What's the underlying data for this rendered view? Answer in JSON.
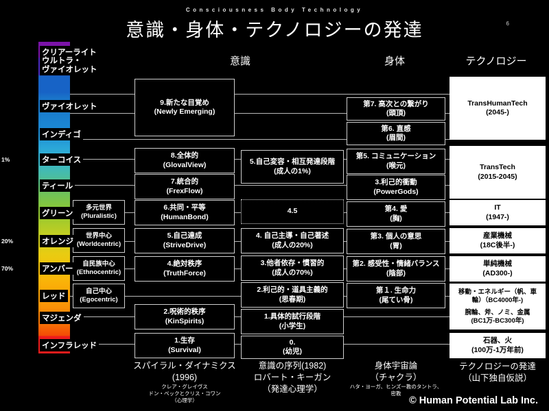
{
  "header": {
    "eyebrow": "Consciousness  Body  Technology",
    "title": "意識・身体・テクノロジーの発達",
    "page_number": "6"
  },
  "column_headings": {
    "consciousness": "意識",
    "body": "身体",
    "technology": "テクノロジー"
  },
  "spectrum": {
    "levels": [
      {
        "label": "クリアーライト",
        "pct": ""
      },
      {
        "label": "ウルトラ・\nヴァイオレット",
        "pct": ""
      },
      {
        "label": "ヴァイオレット",
        "pct": ""
      },
      {
        "label": "インディゴ",
        "pct": ""
      },
      {
        "label": "ターコイス",
        "pct": "1%"
      },
      {
        "label": "ティール",
        "pct": ""
      },
      {
        "label": "グリーン",
        "pct": ""
      },
      {
        "label": "オレンジ",
        "pct": "20%"
      },
      {
        "label": "アンバー",
        "pct": "70%"
      },
      {
        "label": "レッド",
        "pct": ""
      },
      {
        "label": "マジェンダ",
        "pct": ""
      },
      {
        "label": "インフラレッド",
        "pct": ""
      }
    ]
  },
  "worldviews": [
    {
      "l1": "多元世界",
      "l2": "(Pluralistic)"
    },
    {
      "l1": "世界中心",
      "l2": "(Worldcentric)"
    },
    {
      "l1": "自民族中心",
      "l2": "(Ethnocentric)"
    },
    {
      "l1": "自己中心",
      "l2": "(Egocentric)"
    }
  ],
  "spiral_dynamics": {
    "items": [
      {
        "l1": "9.新たな目覚め",
        "l2": "(Newly Emerging)"
      },
      {
        "l1": "8.全体的",
        "l2": "(GlovalView)"
      },
      {
        "l1": "7.統合的",
        "l2": "(FrexFlow)"
      },
      {
        "l1": "6.共同・平等",
        "l2": "(HumanBond)"
      },
      {
        "l1": "5.自己達成",
        "l2": "(StriveDrive)"
      },
      {
        "l1": "4.絶対秩序",
        "l2": "(TruthForce)"
      },
      {
        "l1": "2.呪術的秩序",
        "l2": "(KinSpirits)"
      },
      {
        "l1": "1.生存",
        "l2": "(Survival)"
      }
    ],
    "detached_item": {
      "l1": "3.利己的衝動",
      "l2": "(PowerGods)"
    },
    "footer": {
      "f1": "スパイラル・ダイナミクス",
      "f2": "(1996)",
      "f3": "クレア・グレイヴス",
      "f4": "ドン・ベックとクリス・コワン",
      "f5": "（心理学）"
    }
  },
  "kegan": {
    "items": [
      {
        "l1": "5.自己変容・相互発達段階",
        "l2": "(成人の1%)"
      },
      {
        "l1": "4.5",
        "l2": "",
        "dotted": true
      },
      {
        "l1": "4. 自己主導・自己著述",
        "l2": "(成人の20%)"
      },
      {
        "l1": "3.他者依存・慣習的",
        "l2": "(成人の70%)"
      },
      {
        "l1": "2.利己的・道具主義的",
        "l2": "(思春期)"
      },
      {
        "l1": "1.具体的試行段階",
        "l2": "(小学生)"
      },
      {
        "l1": "0.",
        "l2": "(幼児)"
      }
    ],
    "footer": {
      "f1": "意識の序列(1982)",
      "f2": "ロバート・キーガン",
      "f3": "（発達心理学）"
    }
  },
  "body_chakras": {
    "items": [
      {
        "l1": "第7. 高次との繋がり",
        "l2": "(頭頂)"
      },
      {
        "l1": "第6. 直感",
        "l2": "(眉間)"
      },
      {
        "l1": "第5. コミュニケーション",
        "l2": "(喉元)"
      },
      {
        "l1": "第4. 愛",
        "l2": "(胸)"
      },
      {
        "l1": "第3. 個人の意思",
        "l2": "(胃)"
      },
      {
        "l1": "第2. 感受性・情緒バランス",
        "l2": "(陰部)"
      },
      {
        "l1": "第１. 生命力",
        "l2": "(尾てい骨)"
      }
    ],
    "footer": {
      "f1": "身体宇宙論",
      "f2": "（チャクラ）",
      "f3": "ハタ・ヨーガ、ヒンズー教のタントラ、",
      "f4": "密教"
    }
  },
  "technology": {
    "items": [
      {
        "l1": "TransHumanTech",
        "l2": "(2045-)"
      },
      {
        "l1": "TransTech",
        "l2": "(2015-2045)"
      },
      {
        "l1": "IT",
        "l2": "(1947-)"
      },
      {
        "l1": "産業機械",
        "l2": "(18C後半-)"
      },
      {
        "l1": "単純機械",
        "l2": "(AD300-)"
      },
      {
        "l1": "移動・エネルギー（帆、車",
        "l2": "輪）（BC4000年-)"
      },
      {
        "l1": "腕輪、斧、ノミ、金属",
        "l2": "(BC1万-BC300年)"
      },
      {
        "l1": "石器、火",
        "l2": "(100万-1万年前)"
      }
    ],
    "footer": {
      "f1": "テクノロジーの発達",
      "f2": "（山下独自仮説）"
    }
  },
  "copyright": "© Human Potential Lab Inc.",
  "colors": {
    "background": "#000000",
    "line": "#b9b9b9",
    "box_border": "#cfcfcf",
    "tech_box_fill": "#ffffff",
    "text": "#ffffff"
  }
}
